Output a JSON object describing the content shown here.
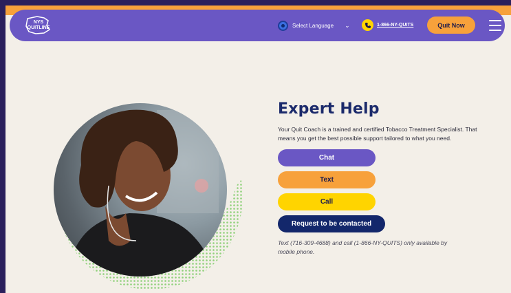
{
  "header": {
    "logo_text_line1": "NYS",
    "logo_text_line2": "QUITLINE",
    "language_label": "Select Language",
    "language_chevron": "⌄",
    "phone_label": "1-866-NY-QUITS",
    "quit_now_label": "Quit Now",
    "menu_icon": "hamburger-icon"
  },
  "main": {
    "title": "Expert Help",
    "description": "Your Quit Coach is a trained and certified Tobacco Treatment Specialist. That means you get the best possible support tailored to what you need.",
    "buttons": {
      "chat": "Chat",
      "text": "Text",
      "call": "Call",
      "request": "Request to be contacted"
    },
    "note": "Text (716-309-4688) and call (1-866-NY-QUITS) only available by mobile phone."
  },
  "colors": {
    "nav_purple": "#6a57c4",
    "accent_orange": "#f7a13b",
    "accent_yellow": "#ffd400",
    "navy": "#13276b",
    "background": "#f3efe8"
  }
}
